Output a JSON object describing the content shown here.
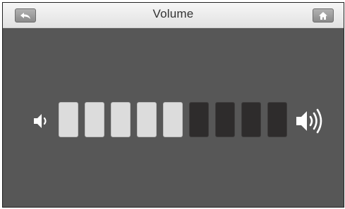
{
  "header": {
    "title": "Volume",
    "back_icon": "back-arrow-icon",
    "home_icon": "home-icon"
  },
  "volume": {
    "level": 5,
    "max": 9,
    "low_icon": "speaker-low-icon",
    "high_icon": "speaker-high-icon"
  },
  "colors": {
    "background": "#575757",
    "bar_on": "#dcdcdc",
    "bar_off": "#2e2c2c",
    "titlebar": "#eeeeee"
  }
}
